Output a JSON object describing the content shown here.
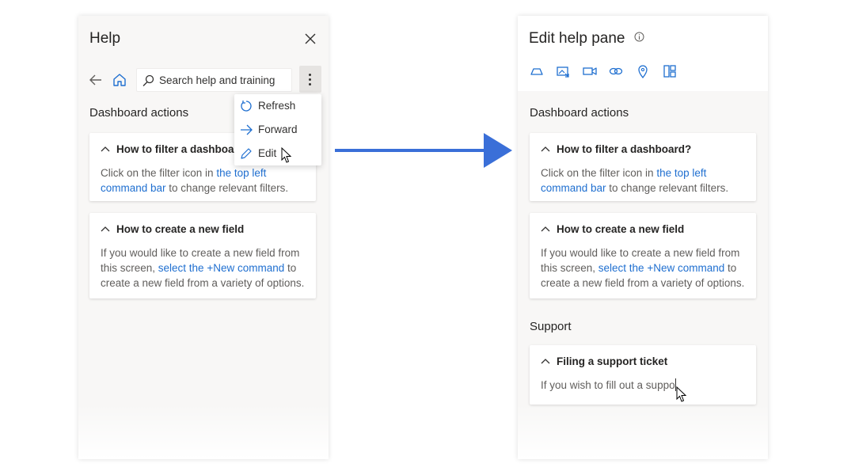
{
  "left_panel": {
    "title": "Help",
    "search": {
      "placeholder": "Search help and training"
    },
    "menu": {
      "items": [
        {
          "label": "Refresh",
          "icon": "refresh-icon"
        },
        {
          "label": "Forward",
          "icon": "forward-arrow-icon"
        },
        {
          "label": "Edit",
          "icon": "pencil-icon"
        }
      ]
    },
    "section_title": "Dashboard actions",
    "cards": [
      {
        "heading": "How to filter a dashboard?",
        "body_pre": "Click on the filter icon in ",
        "link": "the top left command bar",
        "body_post": " to change relevant filters."
      },
      {
        "heading": "How to create a new field",
        "body_pre": "If you would like to create a new field from this screen, ",
        "link": "select the +New command",
        "body_post": " to create a new field from a variety of options."
      }
    ]
  },
  "right_panel": {
    "title": "Edit help pane",
    "toolbar_icons": [
      "section-icon",
      "image-icon",
      "video-icon",
      "link-icon",
      "location-icon",
      "layout-icon"
    ],
    "section_title": "Dashboard actions",
    "cards": [
      {
        "heading": "How to filter a dashboard?",
        "body_pre": "Click on the filter icon in ",
        "link": "the top left command bar",
        "body_post": " to change relevant filters."
      },
      {
        "heading": "How to create a new field",
        "body_pre": "If you would like to create a new field from this screen, ",
        "link": "select the +New command",
        "body_post": " to create a new field from a variety of options."
      }
    ],
    "support_title": "Support",
    "support_card": {
      "heading": "Filing a support ticket",
      "body": "If you wish to fill out a suppo"
    }
  },
  "colors": {
    "accent": "#1f6fd0",
    "arrow": "#3a6fd8",
    "panel_bg": "#f8f7f6"
  }
}
